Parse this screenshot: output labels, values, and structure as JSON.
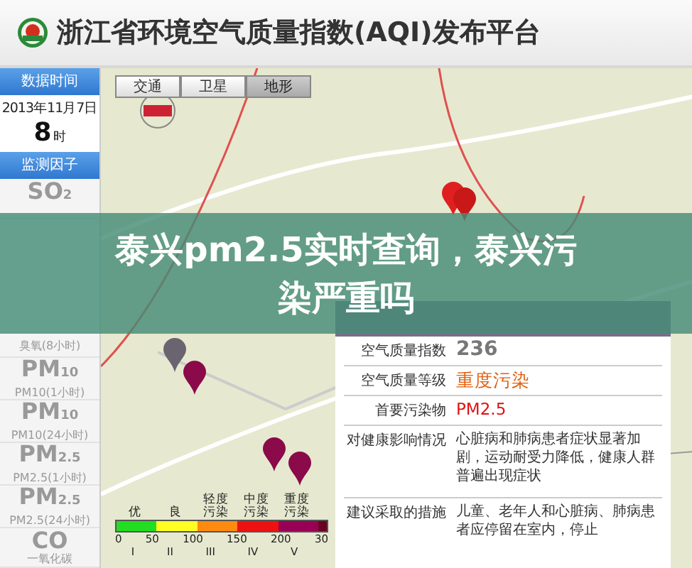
{
  "header": {
    "title": "浙江省环境空气质量指数(AQI)发布平台"
  },
  "sidebar": {
    "time_header": "数据时间",
    "date": "2013年11月7日",
    "hour": "8",
    "hour_unit": "时",
    "factors_header": "监测因子",
    "factors": [
      {
        "symbol": "SO$_{2}$"
      },
      {
        "name": "臭氧(8小时)"
      },
      {
        "symbol": "PM$_{10}$",
        "name": "PM10(1小时)"
      },
      {
        "symbol": "PM$_{10}$",
        "name": "PM10(24小时)"
      },
      {
        "symbol": "PM$_{2.5}$",
        "name": "PM2.5(1小时)"
      },
      {
        "symbol": "PM$_{2.5}$",
        "name": "PM2.5(24小时)"
      },
      {
        "symbol": "CO",
        "name": "一氧化碳"
      }
    ]
  },
  "map": {
    "tabs": [
      {
        "label": "交通",
        "selected": false
      },
      {
        "label": "卫星",
        "selected": false
      },
      {
        "label": "地形",
        "selected": true
      }
    ],
    "pins": [
      {
        "color": "#e02020"
      },
      {
        "color": "#c81818"
      },
      {
        "color": "#6a6470"
      },
      {
        "color": "#8a0a4a"
      },
      {
        "color": "#8a0a4a"
      },
      {
        "color": "#8a0a4a"
      }
    ],
    "legend": {
      "labels": [
        "优",
        "良",
        "轻度污染",
        "中度污染",
        "重度污染"
      ],
      "segments": [
        {
          "color": "#22dd22"
        },
        {
          "color": "#ffff22"
        },
        {
          "color": "#ff8a10"
        },
        {
          "color": "#ee1111"
        },
        {
          "color": "#990055"
        },
        {
          "color": "#6a0020"
        }
      ],
      "ticks": [
        "0",
        "50",
        "100",
        "150",
        "200",
        "30"
      ],
      "grades": [
        "I",
        "II",
        "III",
        "IV",
        "V"
      ]
    }
  },
  "info_panel": {
    "rows": [
      {
        "kind": "number",
        "label": "空气质量指数",
        "value": "236"
      },
      {
        "kind": "level",
        "label": "空气质量等级",
        "value": "重度污染"
      },
      {
        "kind": "pollutant",
        "label": "首要污染物",
        "value": "PM2.5"
      },
      {
        "kind": "text",
        "label": "对健康影响情况",
        "value": "心脏病和肺病患者症状显著加剧，运动耐受力降低，健康人群普遍出现症状"
      },
      {
        "kind": "text",
        "label": "建议采取的措施",
        "value": "儿童、老年人和心脏病、肺病患者应停留在室内，停止"
      }
    ]
  },
  "banner": {
    "title": "泰兴pm2.5实时查询，泰兴污染严重吗"
  }
}
